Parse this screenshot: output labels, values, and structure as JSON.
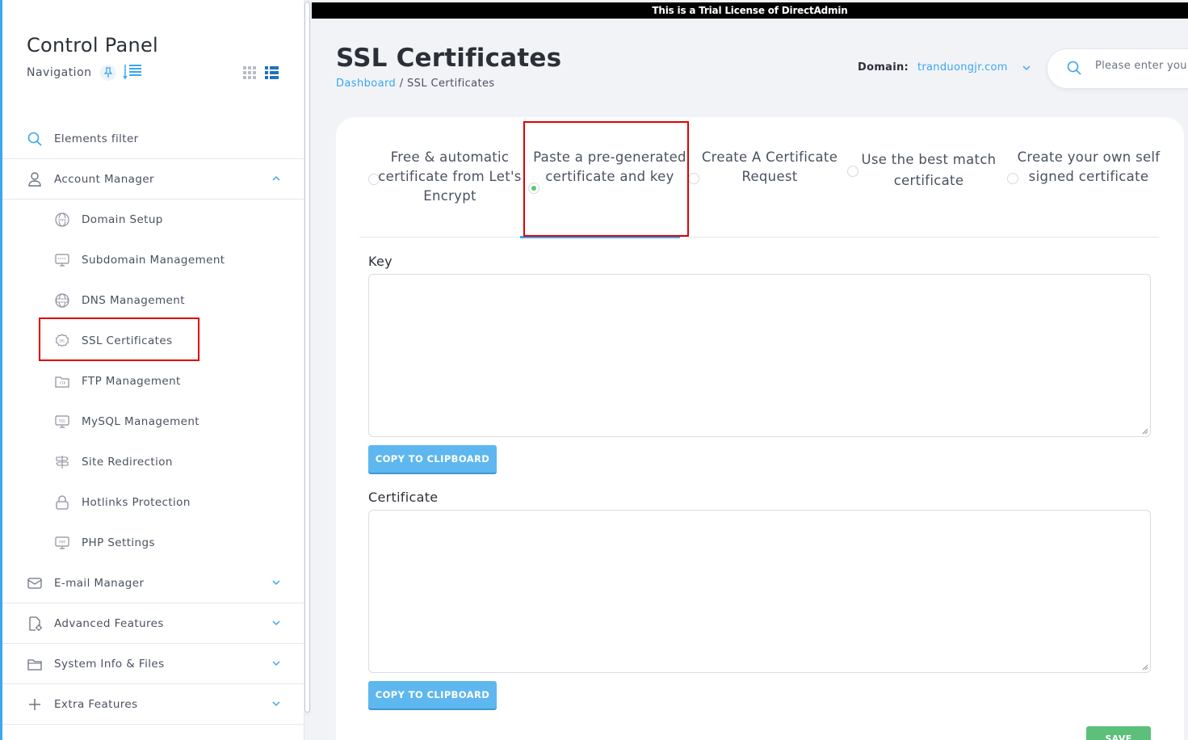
{
  "trial_banner": "This is a Trial License of DirectAdmin",
  "sidebar": {
    "title": "Control Panel",
    "nav_label": "Navigation",
    "filter_label": "Elements filter",
    "groups": [
      {
        "label": "Account Manager",
        "icon": "user-icon",
        "expanded": true
      },
      {
        "label": "E-mail Manager",
        "icon": "mail-icon",
        "expanded": false
      },
      {
        "label": "Advanced Features",
        "icon": "advanced-file-icon",
        "expanded": false
      },
      {
        "label": "System Info & Files",
        "icon": "folder-icon",
        "expanded": false
      },
      {
        "label": "Extra Features",
        "icon": "plus-icon",
        "expanded": false
      }
    ],
    "account_items": [
      {
        "label": "Domain Setup",
        "icon": "www-globe-icon"
      },
      {
        "label": "Subdomain Management",
        "icon": "subdomain-monitor-icon"
      },
      {
        "label": "DNS Management",
        "icon": "dns-globe-icon"
      },
      {
        "label": "SSL Certificates",
        "icon": "ssl-badge-icon",
        "active": true
      },
      {
        "label": "FTP Management",
        "icon": "ftp-folder-icon"
      },
      {
        "label": "MySQL Management",
        "icon": "sql-monitor-icon"
      },
      {
        "label": "Site Redirection",
        "icon": "signpost-icon"
      },
      {
        "label": "Hotlinks Protection",
        "icon": "lock-icon"
      },
      {
        "label": "PHP Settings",
        "icon": "php-monitor-icon"
      }
    ]
  },
  "header": {
    "title": "SSL Certificates",
    "breadcrumb": {
      "link": "Dashboard",
      "separator": "/",
      "current": "SSL Certificates"
    },
    "domain_label": "Domain:",
    "domain_value": "tranduongjr.com",
    "search_placeholder": "Please enter you"
  },
  "options": [
    {
      "label": "Free & automatic certificate from Let's Encrypt",
      "selected": false
    },
    {
      "label": "Paste a pre-generated certificate and key",
      "selected": true
    },
    {
      "label": "Create A Certificate Request",
      "selected": false
    },
    {
      "label": "Use the best match certificate",
      "selected": false
    },
    {
      "label": "Create your own self signed certificate",
      "selected": false
    }
  ],
  "fields": {
    "key_label": "Key",
    "key_value": "",
    "certificate_label": "Certificate",
    "certificate_value": "",
    "copy_label": "COPY TO CLIPBOARD",
    "save_label": "SAVE"
  },
  "colors": {
    "accent": "#3aa7f0",
    "highlight": "#e00000",
    "save": "#5cc07a",
    "radio_on": "#4cd06f"
  }
}
